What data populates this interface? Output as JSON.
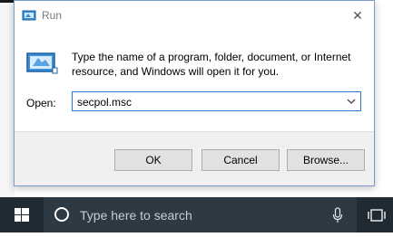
{
  "dialog": {
    "title": "Run",
    "description": "Type the name of a program, folder, document, or Internet resource, and Windows will open it for you.",
    "open_label": "Open:",
    "open_value": "secpol.msc",
    "buttons": {
      "ok": "OK",
      "cancel": "Cancel",
      "browse": "Browse..."
    },
    "close_glyph": "✕"
  },
  "taskbar": {
    "search_placeholder": "Type here to search"
  },
  "icons": [
    "run-icon",
    "close-icon",
    "chevron-down-icon",
    "windows-start-icon",
    "cortana-icon",
    "microphone-icon",
    "task-view-icon"
  ],
  "colors": {
    "accent_border": "#2a7bd1",
    "taskbar": "#1f2a33",
    "search_box": "#2d3a44"
  }
}
